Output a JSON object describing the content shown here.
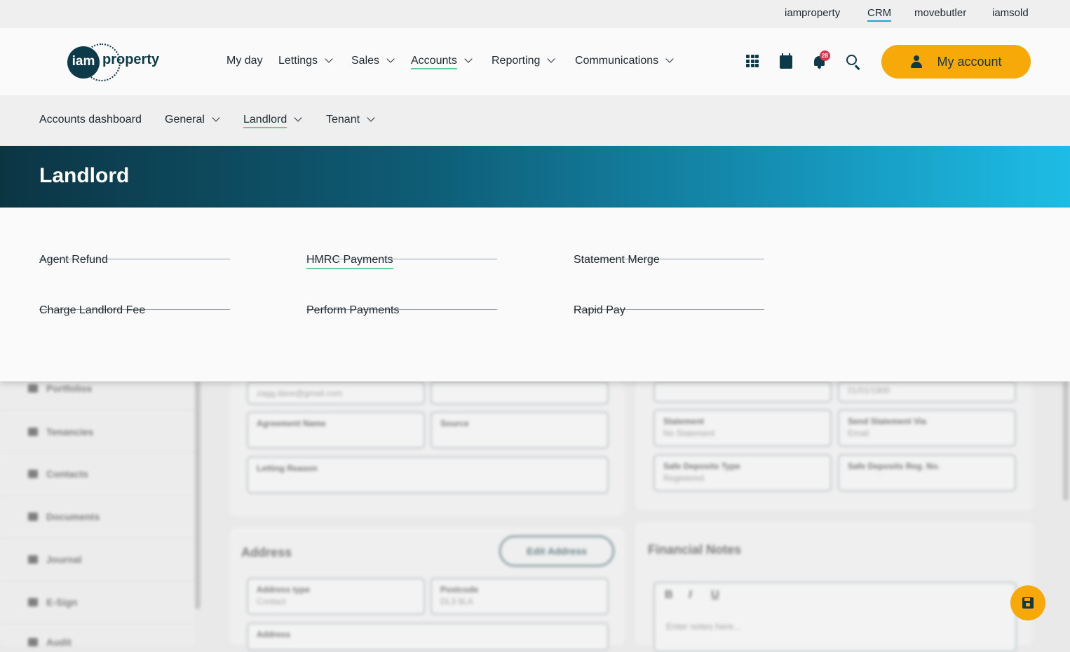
{
  "brand_links": [
    "iamproperty",
    "CRM",
    "movebutler",
    "iamsold"
  ],
  "logo": {
    "mark": "iam",
    "word": "property"
  },
  "main_nav": [
    {
      "label": "My day"
    },
    {
      "label": "Lettings"
    },
    {
      "label": "Sales"
    },
    {
      "label": "Accounts"
    },
    {
      "label": "Reporting"
    },
    {
      "label": "Communications"
    }
  ],
  "header": {
    "notifications_count": "28",
    "my_account_label": "My account"
  },
  "sub_nav": [
    {
      "label": "Accounts dashboard"
    },
    {
      "label": "General"
    },
    {
      "label": "Landlord"
    },
    {
      "label": "Tenant"
    }
  ],
  "banner": {
    "title": "Landlord"
  },
  "landlord_menu": [
    {
      "label": "Agent Refund"
    },
    {
      "label": "HMRC Payments"
    },
    {
      "label": "Statement Merge"
    },
    {
      "label": "Charge Landlord Fee"
    },
    {
      "label": "Perform Payments"
    },
    {
      "label": "Rapid Pay"
    }
  ],
  "background": {
    "sidebar": [
      "Portfolios",
      "Tenancies",
      "Contacts",
      "Documents",
      "Journal",
      "E-Sign",
      "Audit"
    ],
    "fields": {
      "email_value": "zagg.dave@gmail.com",
      "agreement_name": "Agreement Name",
      "source": "Source",
      "letting_reason": "Letting Reason",
      "date_value": "01/01/1900",
      "statement_label": "Statement",
      "statement_value": "No Statement",
      "send_via_label": "Send Statement Via",
      "send_via_value": "Email",
      "deposit_type_label": "Safe Deposits Type",
      "deposit_type_value": "Registered",
      "deposit_reg_label": "Safe Deposits Reg. No.",
      "address_type_label": "Address type",
      "address_type_value": "Contact",
      "postcode_label": "Postcode",
      "postcode_value": "DL3 8LA",
      "address_label": "Address"
    },
    "address_title": "Address",
    "edit_address_label": "Edit Address",
    "financial_notes_title": "Financial Notes",
    "notes_placeholder": "Enter notes here...",
    "editor_buttons": [
      "B",
      "I",
      "U"
    ]
  }
}
